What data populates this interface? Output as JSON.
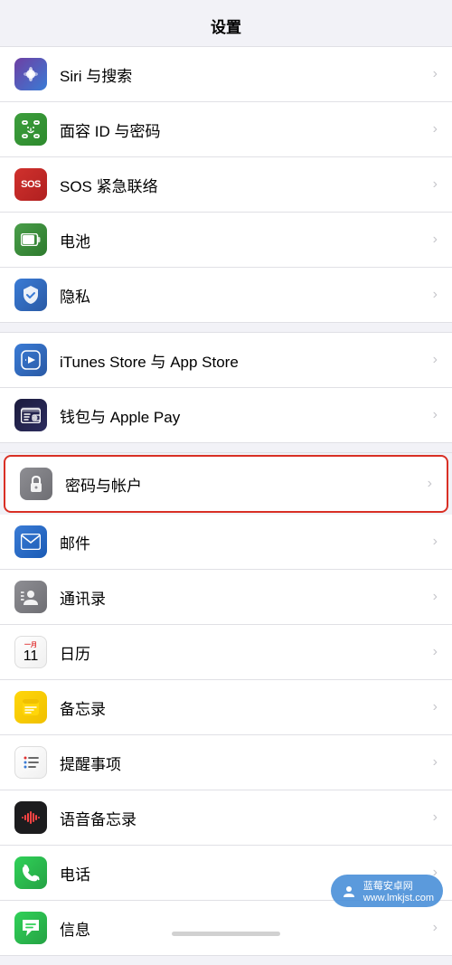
{
  "page": {
    "title": "设置"
  },
  "sections": [
    {
      "id": "section1",
      "rows": [
        {
          "id": "siri",
          "icon": "siri",
          "label": "Siri 与搜索",
          "iconType": "siri"
        },
        {
          "id": "faceid",
          "icon": "faceid",
          "label": "面容 ID 与密码",
          "iconType": "faceid"
        },
        {
          "id": "sos",
          "icon": "sos",
          "label": "SOS 紧急联络",
          "iconType": "sos"
        },
        {
          "id": "battery",
          "icon": "battery",
          "label": "电池",
          "iconType": "battery"
        },
        {
          "id": "privacy",
          "icon": "privacy",
          "label": "隐私",
          "iconType": "privacy"
        }
      ]
    },
    {
      "id": "section2",
      "rows": [
        {
          "id": "itunes",
          "icon": "itunes",
          "label": "iTunes Store 与 App Store",
          "iconType": "itunes"
        },
        {
          "id": "wallet",
          "icon": "wallet",
          "label": "钱包与 Apple Pay",
          "iconType": "wallet"
        }
      ]
    },
    {
      "id": "section3",
      "rows": [
        {
          "id": "passwords",
          "icon": "passwords",
          "label": "密码与帐户",
          "iconType": "passwords",
          "highlighted": true
        },
        {
          "id": "mail",
          "icon": "mail",
          "label": "邮件",
          "iconType": "mail"
        },
        {
          "id": "contacts",
          "icon": "contacts",
          "label": "通讯录",
          "iconType": "contacts"
        },
        {
          "id": "calendar",
          "icon": "calendar",
          "label": "日历",
          "iconType": "calendar"
        },
        {
          "id": "notes",
          "icon": "notes",
          "label": "备忘录",
          "iconType": "notes"
        },
        {
          "id": "reminders",
          "icon": "reminders",
          "label": "提醒事项",
          "iconType": "reminders"
        },
        {
          "id": "voice",
          "icon": "voice",
          "label": "语音备忘录",
          "iconType": "voice"
        },
        {
          "id": "phone",
          "icon": "phone",
          "label": "电话",
          "iconType": "phone"
        },
        {
          "id": "messages",
          "icon": "messages",
          "label": "信息",
          "iconType": "messages"
        }
      ]
    }
  ],
  "icons": {
    "siri_symbol": "◎",
    "chevron": "›",
    "watermark_text": "蓝莓安卓网",
    "watermark_url": "www.lmkjst.com"
  }
}
